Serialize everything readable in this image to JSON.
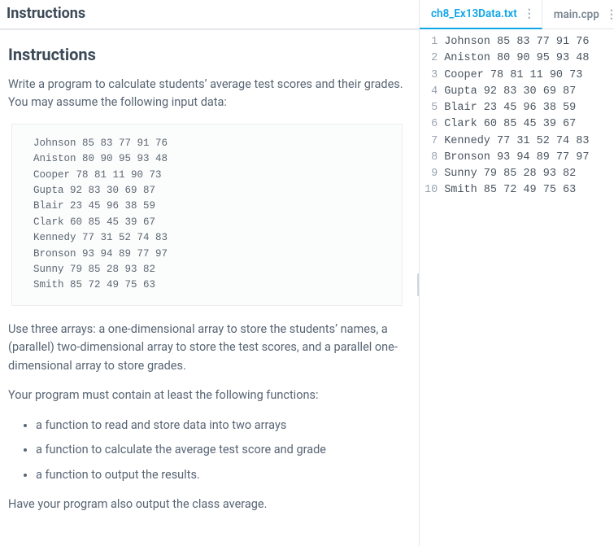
{
  "left": {
    "header": "Instructions",
    "title": "Instructions",
    "intro": "Write a program to calculate students’ average test scores and their grades. You may assume the following input data:",
    "sample_data": "Johnson 85 83 77 91 76\nAniston 80 90 95 93 48\nCooper 78 81 11 90 73\nGupta 92 83 30 69 87\nBlair 23 45 96 38 59\nClark 60 85 45 39 67\nKennedy 77 31 52 74 83\nBronson 93 94 89 77 97\nSunny 79 85 28 93 82\nSmith 85 72 49 75 63",
    "para2": "Use three arrays: a one-dimensional array to store the students’ names, a (parallel) two-dimensional array to store the test scores, and a parallel one-dimensional array to store grades.",
    "para3": "Your program must contain at least the following functions:",
    "bullets": [
      "a function to read and store data into two arrays",
      "a function to calculate the average test score and grade",
      "a function to output the results."
    ],
    "para4": "Have your program also output the class average."
  },
  "right": {
    "tabs": [
      {
        "label": "ch8_Ex13Data.txt",
        "active": true
      },
      {
        "label": "main.cpp",
        "active": false
      }
    ],
    "file_lines": [
      "Johnson 85 83 77 91 76",
      "Aniston 80 90 95 93 48",
      "Cooper 78 81 11 90 73",
      "Gupta 92 83 30 69 87",
      "Blair 23 45 96 38 59",
      "Clark 60 85 45 39 67",
      "Kennedy 77 31 52 74 83",
      "Bronson 93 94 89 77 97",
      "Sunny 79 85 28 93 82",
      "Smith 85 72 49 75 63"
    ]
  }
}
